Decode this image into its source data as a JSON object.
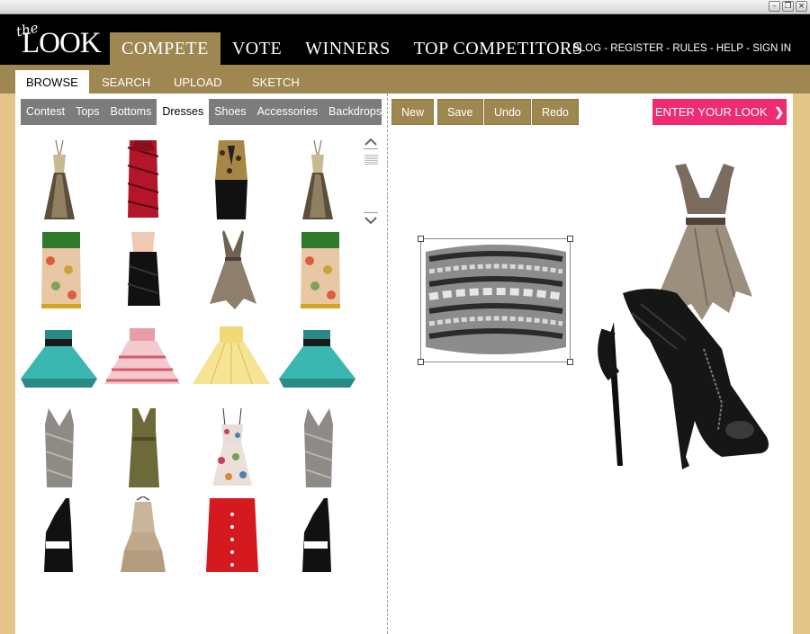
{
  "window": {
    "controls": [
      "minimize-icon",
      "restore-icon",
      "close-icon"
    ]
  },
  "logo": {
    "line1": "the",
    "line2": "LOOK"
  },
  "main_nav": [
    {
      "label": "COMPETE",
      "active": true
    },
    {
      "label": "VOTE",
      "active": false
    },
    {
      "label": "WINNERS",
      "active": false
    },
    {
      "label": "TOP COMPETITORS",
      "active": false
    }
  ],
  "util_nav": [
    "BLOG",
    "REGISTER",
    "RULES",
    "HELP",
    "SIGN IN"
  ],
  "util_nav_separator": " - ",
  "sub_nav": [
    {
      "label": "BROWSE",
      "active": true
    },
    {
      "label": "SEARCH",
      "active": false
    },
    {
      "label": "UPLOAD",
      "active": false
    },
    {
      "label": "SKETCH",
      "active": false
    }
  ],
  "categories": [
    {
      "label": "Contest",
      "active": false
    },
    {
      "label": "Tops",
      "active": false
    },
    {
      "label": "Bottoms",
      "active": false
    },
    {
      "label": "Dresses",
      "active": true
    },
    {
      "label": "Shoes",
      "active": false
    },
    {
      "label": "Accessories",
      "active": false
    },
    {
      "label": "Backdrops",
      "active": false
    }
  ],
  "scroll": {
    "up_icon": "chevron-up-icon",
    "down_icon": "chevron-down-icon"
  },
  "catalog_items": [
    {
      "name": "beige-sheer-halter-dress"
    },
    {
      "name": "red-bandage-dress"
    },
    {
      "name": "black-gold-leopard-dress"
    },
    {
      "name": "beige-sheer-halter-dress"
    },
    {
      "name": "floral-strapless-dress-green-bodice"
    },
    {
      "name": "black-draped-dress-nude-bodice"
    },
    {
      "name": "taupe-ruffled-vneck-dress"
    },
    {
      "name": "floral-strapless-dress-green-bodice"
    },
    {
      "name": "teal-polka-tulle-strapless-dress"
    },
    {
      "name": "pink-ruffle-tulle-dress"
    },
    {
      "name": "yellow-strapless-tulle-dress"
    },
    {
      "name": "teal-polka-tulle-strapless-dress"
    },
    {
      "name": "silver-metallic-vneck-sheath"
    },
    {
      "name": "olive-halter-dress"
    },
    {
      "name": "floral-sundress"
    },
    {
      "name": "silver-metallic-vneck-sheath"
    },
    {
      "name": "black-one-shoulder-cutout-dress"
    },
    {
      "name": "beige-tiered-slip-dress"
    },
    {
      "name": "red-strapless-button-dress"
    },
    {
      "name": "black-one-shoulder-cutout-dress"
    }
  ],
  "toolbar": {
    "new": "New",
    "save": "Save",
    "undo": "Undo",
    "redo": "Redo"
  },
  "enter_button": {
    "label": "ENTER YOUR LOOK",
    "icon": "chevron-right-icon",
    "color": "#ee2b74"
  },
  "canvas_items": [
    {
      "name": "silver-chain-cuff-bracelet",
      "selected": true
    },
    {
      "name": "taupe-ruffled-vneck-dress",
      "selected": false
    },
    {
      "name": "black-leather-peeptoe-bootie",
      "selected": false
    }
  ],
  "colors": {
    "header": "#000000",
    "accent": "#9f8751",
    "frame": "#e3c588",
    "category_bar": "#7c7c7c",
    "enter_button": "#ee2b74"
  }
}
